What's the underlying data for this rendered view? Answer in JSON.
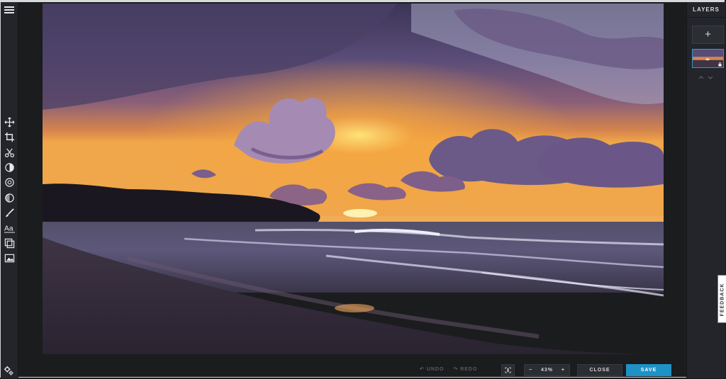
{
  "toolbar": {
    "tools": [
      "move-icon",
      "crop-icon",
      "cut-icon",
      "adjust-icon",
      "filter-icon",
      "vignette-icon",
      "brush-icon",
      "text-icon",
      "frame-icon",
      "image-icon"
    ],
    "settings_icon": "settings-icon"
  },
  "layers_panel": {
    "title": "LAYERS",
    "add_label": "+",
    "arrows": "^ v"
  },
  "feedback": {
    "label": "FEEDBACK"
  },
  "bottom": {
    "undo_label": "UNDO",
    "redo_label": "REDO",
    "zoom_minus": "−",
    "zoom_value": "43%",
    "zoom_plus": "+",
    "close_label": "CLOSE",
    "save_label": "SAVE"
  },
  "colors": {
    "accent": "#1e92c6",
    "panel": "#23252a",
    "background": "#1b1c1e"
  }
}
